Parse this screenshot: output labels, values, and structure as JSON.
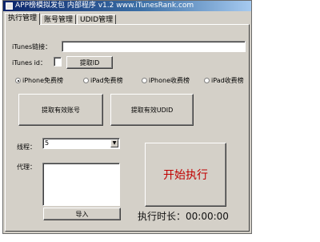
{
  "window": {
    "title": "APP榜模拟发包 内部程序 v1.2 www.iTunesRank.com"
  },
  "tabs": [
    {
      "label": "执行管理"
    },
    {
      "label": "账号管理"
    },
    {
      "label": "UDID管理"
    }
  ],
  "form": {
    "itunes_link_label": "iTunes链接：",
    "itunes_link_value": "",
    "itunes_id_label": "iTunes id：",
    "itunes_id_value": "",
    "get_id_button": "提取ID"
  },
  "radios": [
    {
      "label": "iPhone免费榜",
      "selected": true
    },
    {
      "label": "iPad免费榜",
      "selected": false
    },
    {
      "label": "iPhone收费榜",
      "selected": false
    },
    {
      "label": "iPad收费榜",
      "selected": false
    }
  ],
  "actions": {
    "get_accounts": "提取有效账号",
    "get_udid": "提取有效UDID",
    "start": "开始执行",
    "import": "导入"
  },
  "threads": {
    "label": "线程：",
    "value": "5"
  },
  "proxy": {
    "label": "代理：",
    "value": ""
  },
  "timer": {
    "text": "执行时长：00:00:00"
  }
}
